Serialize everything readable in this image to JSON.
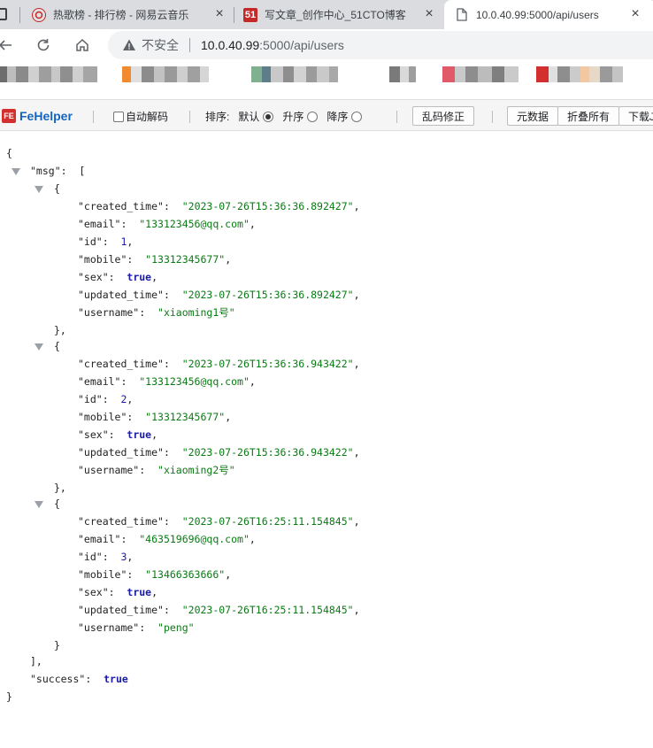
{
  "tabs": [
    {
      "title": "热歌榜 - 排行榜 - 网易云音乐",
      "close": "×"
    },
    {
      "title": "写文章_创作中心_51CTO博客",
      "close": "×",
      "favicon_text": "51"
    },
    {
      "title": "10.0.40.99:5000/api/users",
      "close": "×",
      "active": true
    }
  ],
  "address_bar": {
    "insecure_label": "不安全",
    "host": "10.0.40.99",
    "path": ":5000/api/users"
  },
  "fehelper": {
    "logo_text": "FeHelper",
    "logo_badge": "FE",
    "auto_decode_label": "自动解码",
    "sort_label": "排序:",
    "sort_options": [
      {
        "label": "默认",
        "selected": true
      },
      {
        "label": "升序",
        "selected": false
      },
      {
        "label": "降序",
        "selected": false
      }
    ],
    "fix_encoding_button": "乱码修正",
    "raw_data_button": "元数据",
    "collapse_all_button": "折叠所有",
    "download_button": "下载J"
  },
  "json": {
    "msg_key": "\"msg\"",
    "success_key": "\"success\"",
    "success_value": "true",
    "records": [
      {
        "created_time": "\"2023-07-26T15:36:36.892427\"",
        "email": "\"133123456@qq.com\"",
        "id": "1",
        "mobile": "\"13312345677\"",
        "sex": "true",
        "updated_time": "\"2023-07-26T15:36:36.892427\"",
        "username": "\"xiaoming1号\""
      },
      {
        "created_time": "\"2023-07-26T15:36:36.943422\"",
        "email": "\"133123456@qq.com\"",
        "id": "2",
        "mobile": "\"13312345677\"",
        "sex": "true",
        "updated_time": "\"2023-07-26T15:36:36.943422\"",
        "username": "\"xiaoming2号\""
      },
      {
        "created_time": "\"2023-07-26T16:25:11.154845\"",
        "email": "\"463519696@qq.com\"",
        "id": "3",
        "mobile": "\"13466363666\"",
        "sex": "true",
        "updated_time": "\"2023-07-26T16:25:11.154845\"",
        "username": "\"peng\""
      }
    ],
    "field_keys": {
      "created_time": "\"created_time\"",
      "email": "\"email\"",
      "id": "\"id\"",
      "mobile": "\"mobile\"",
      "sex": "\"sex\"",
      "updated_time": "\"updated_time\"",
      "username": "\"username\""
    }
  },
  "colors": {
    "string": "#0a7a14",
    "number": "#1a1aa6",
    "keyword": "#1a1aa6",
    "fehelper_brand": "#1565c0"
  }
}
